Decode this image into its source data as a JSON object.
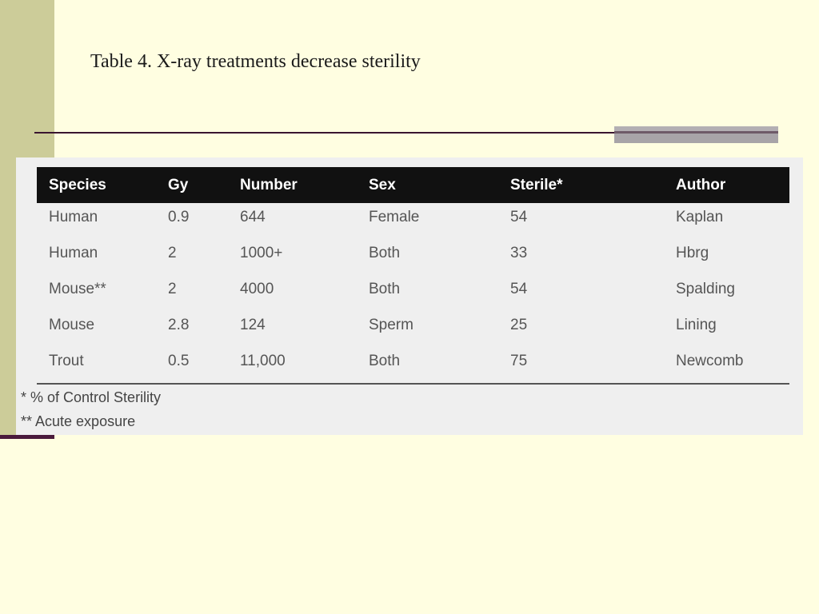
{
  "slide": {
    "title": "Table 4. X-ray treatments decrease sterility"
  },
  "table": {
    "headers": [
      "Species",
      "Gy",
      "Number",
      "Sex",
      "Sterile*",
      "Author"
    ],
    "rows": [
      [
        "Human",
        "0.9",
        "644",
        "Female",
        "54",
        "Kaplan"
      ],
      [
        "Human",
        "2",
        "1000+",
        "Both",
        "33",
        "Hbrg"
      ],
      [
        "Mouse**",
        "2",
        "4000",
        "Both",
        "54",
        "Spalding"
      ],
      [
        "Mouse",
        "2.8",
        "124",
        "Sperm",
        "25",
        "Lining"
      ],
      [
        "Trout",
        "0.5",
        "11,000",
        "Both",
        "75",
        "Newcomb"
      ]
    ],
    "footnotes": [
      "* % of Control Sterility",
      "** Acute exposure"
    ]
  },
  "colors": {
    "background": "#FFFEE1",
    "side_bar": "#CCCC99",
    "header_bg": "#111111",
    "panel_bg": "#EFEFEF",
    "rule": "#3A1530"
  }
}
